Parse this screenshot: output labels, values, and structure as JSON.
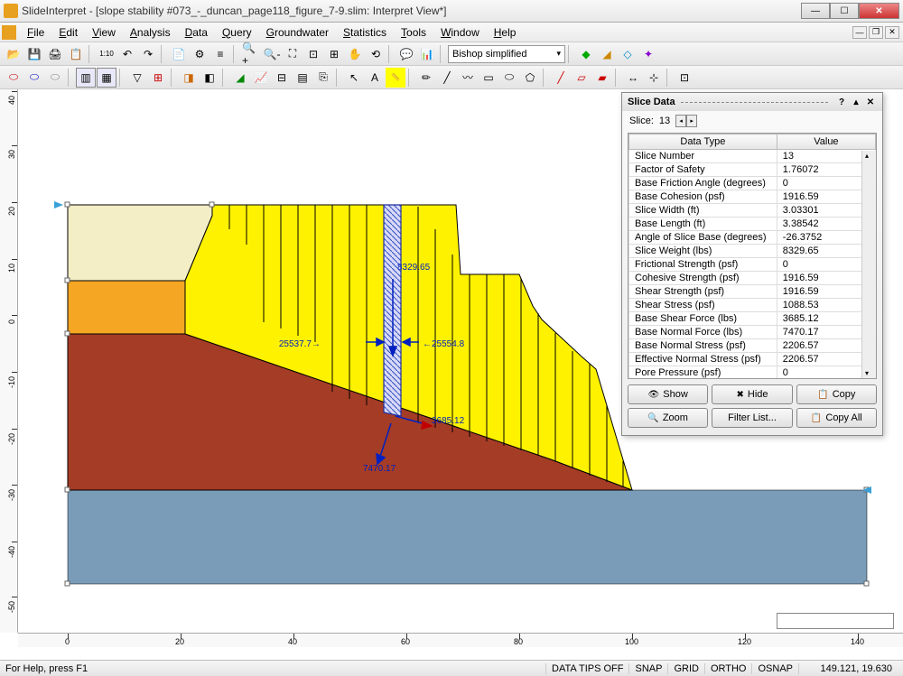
{
  "titlebar": {
    "app": "SlideInterpret",
    "document": "[slope stability #073_-_duncan_page118_figure_7-9.slim: Interpret View*]"
  },
  "menu": [
    "File",
    "Edit",
    "View",
    "Analysis",
    "Data",
    "Query",
    "Groundwater",
    "Statistics",
    "Tools",
    "Window",
    "Help"
  ],
  "toolbar1": {
    "combo": "Bishop simplified"
  },
  "panel": {
    "title": "Slice Data",
    "slice_label": "Slice:",
    "slice_value": "13",
    "headers": [
      "Data Type",
      "Value"
    ],
    "rows": [
      [
        "Slice Number",
        "13"
      ],
      [
        "Factor of Safety",
        "1.76072"
      ],
      [
        "Base Friction Angle (degrees)",
        "0"
      ],
      [
        "Base Cohesion (psf)",
        "1916.59"
      ],
      [
        "Slice Width (ft)",
        "3.03301"
      ],
      [
        "Base Length (ft)",
        "3.38542"
      ],
      [
        "Angle of Slice Base (degrees)",
        "-26.3752"
      ],
      [
        "Slice Weight (lbs)",
        "8329.65"
      ],
      [
        "Frictional Strength (psf)",
        "0"
      ],
      [
        "Cohesive Strength (psf)",
        "1916.59"
      ],
      [
        "Shear Strength (psf)",
        "1916.59"
      ],
      [
        "Shear Stress (psf)",
        "1088.53"
      ],
      [
        "Base Shear Force (lbs)",
        "3685.12"
      ],
      [
        "Base Normal Force (lbs)",
        "7470.17"
      ],
      [
        "Base Normal Stress (psf)",
        "2206.57"
      ],
      [
        "Effective Normal Stress (psf)",
        "2206.57"
      ],
      [
        "Pore Pressure (psf)",
        "0"
      ]
    ],
    "buttons": {
      "show": "Show",
      "hide": "Hide",
      "copy": "Copy",
      "zoom": "Zoom",
      "filter": "Filter List...",
      "copy_all": "Copy All"
    }
  },
  "canvas": {
    "annotations": {
      "weight": "8329.65",
      "left_force": "25537.7",
      "right_force": "25554.8",
      "shear": "3685.12",
      "normal": "7470.17"
    }
  },
  "axes": {
    "x_ticks": [
      0,
      20,
      40,
      60,
      80,
      100,
      120,
      140
    ],
    "y_ticks": [
      40,
      30,
      20,
      10,
      0,
      -10,
      -20,
      -30,
      -40,
      -50
    ]
  },
  "statusbar": {
    "help": "For Help, press F1",
    "tips": "DATA TIPS OFF",
    "snap": "SNAP",
    "grid": "GRID",
    "ortho": "ORTHO",
    "osnap": "OSNAP",
    "coords": "149.121, 19.630"
  }
}
